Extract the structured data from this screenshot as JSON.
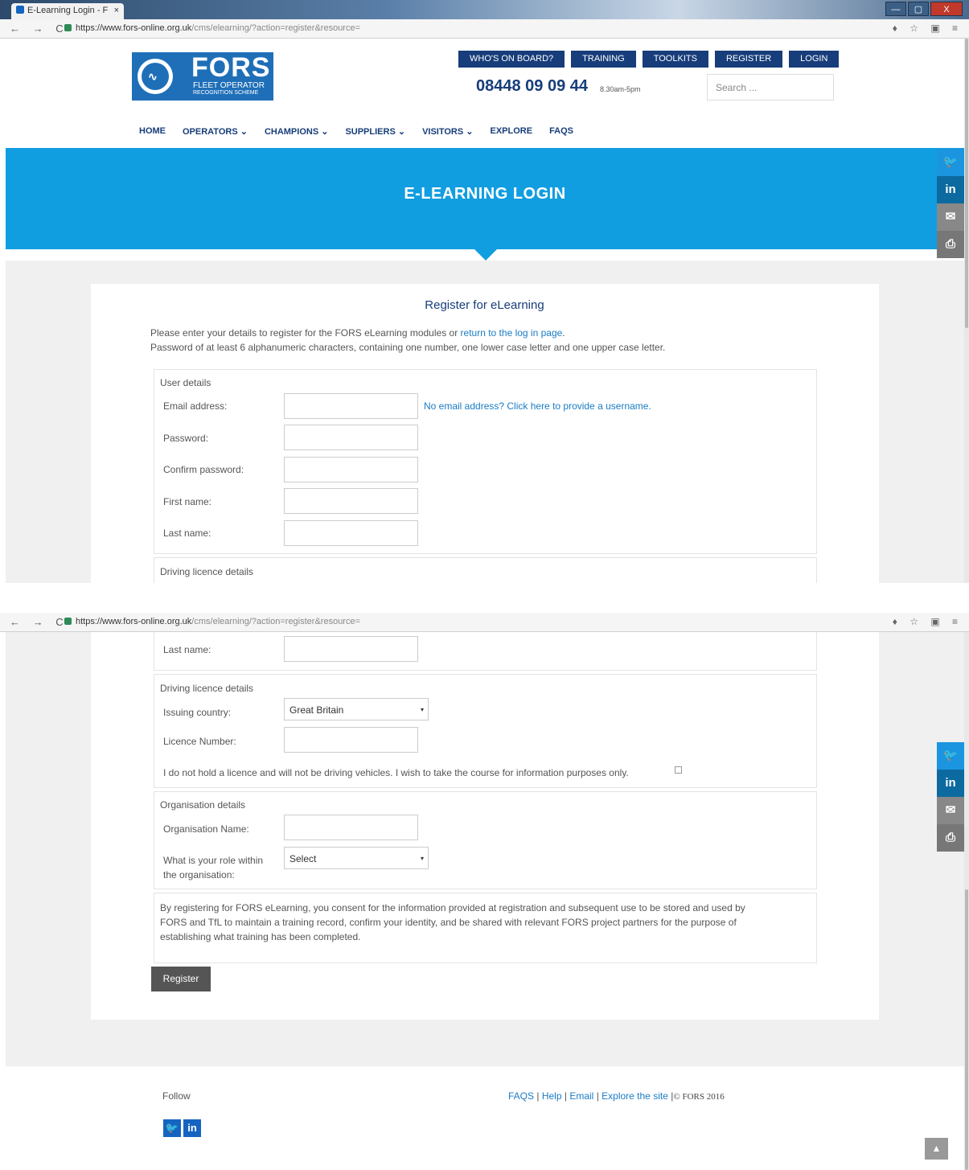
{
  "browser": {
    "tab_title": "E-Learning Login - F",
    "tab_close": "×",
    "url_host": "https://www.fors-online.org.uk",
    "url_path": "/cms/elearning/?action=register&resource=",
    "nav_glyphs": "← → C",
    "tool_glyphs": "♦ ☆ ▣ ≡",
    "win_min": "—",
    "win_max": "▢",
    "win_close": "X"
  },
  "header": {
    "logo_name": "FORS",
    "logo_sub1": "FLEET OPERATOR",
    "logo_sub2": "RECOGNITION SCHEME",
    "top_buttons": [
      "WHO'S ON BOARD?",
      "TRAINING",
      "TOOLKITS",
      "REGISTER",
      "LOGIN"
    ],
    "phone": "08448 09 09 44",
    "hours": "8.30am-5pm",
    "search_placeholder": "Search ...",
    "nav": [
      "HOME",
      "OPERATORS ⌄",
      "CHAMPIONS ⌄",
      "SUPPLIERS ⌄",
      "VISITORS ⌄",
      "EXPLORE",
      "FAQS"
    ]
  },
  "hero": {
    "title": "E-LEARNING LOGIN"
  },
  "social": {
    "twitter": "🐦",
    "linkedin": "in",
    "email": "✉",
    "print": "⎙"
  },
  "form": {
    "heading": "Register for eLearning",
    "intro_line1": "Please enter your details to register for the FORS eLearning modules or ",
    "intro_link": "return to the log in page",
    "intro_line1_end": ".",
    "intro_line2": "Password of at least 6 alphanumeric characters, containing one number, one lower case letter and one upper case letter.",
    "user_details": {
      "legend": "User details",
      "email_label": "Email address:",
      "email_link": "No email address? Click here to provide a username.",
      "password_label": "Password:",
      "confirm_label": "Confirm password:",
      "first_label": "First name:",
      "last_label": "Last name:"
    },
    "licence": {
      "legend": "Driving licence details",
      "country_label": "Issuing country:",
      "country_value": "Great Britain",
      "number_label": "Licence Number:",
      "no_licence_text": "I do not hold a licence and will not be driving vehicles. I wish to take the course for information purposes only."
    },
    "organisation": {
      "legend": "Organisation details",
      "name_label": "Organisation Name:",
      "role_label_1": "What is your role within",
      "role_label_2": "the organisation:",
      "role_value": "Select"
    },
    "consent": [
      "By registering for FORS eLearning, you consent for the information provided at registration and subsequent use to be stored and used by",
      "FORS and TfL to maintain a training record, confirm your identity, and be shared with relevant FORS project partners for the purpose of",
      "establishing what training has been completed."
    ],
    "register_button": "Register",
    "caret": "▾"
  },
  "footer": {
    "follow": "Follow",
    "links": [
      "FAQS",
      "Help",
      "Email",
      "Explore the site"
    ],
    "separator": "|",
    "copyright": "© FORS 2016",
    "twitter": "🐦",
    "linkedin": "in",
    "to_top": "▲"
  }
}
